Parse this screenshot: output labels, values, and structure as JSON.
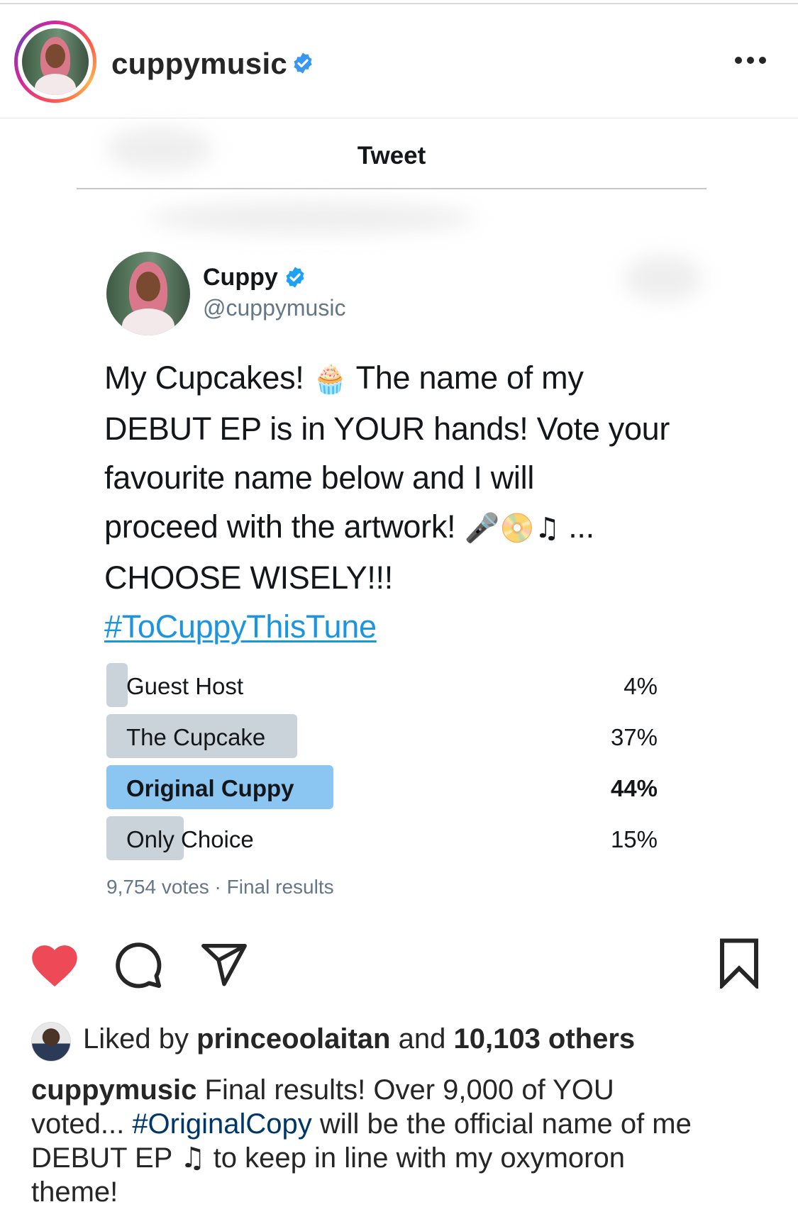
{
  "post": {
    "username": "cuppymusic",
    "verified": true,
    "more_icon": "more-horizontal-icon"
  },
  "tweet": {
    "header_title": "Tweet",
    "author_name": "Cuppy",
    "author_handle": "@cuppymusic",
    "text_lines": [
      "My Cupcakes! ",
      " The name of my",
      "DEBUT EP is in YOUR hands! Vote your",
      "favourite name below and I will",
      "proceed with the artwork! ",
      " ...",
      "CHOOSE WISELY!!!"
    ],
    "emojis": {
      "cupcake": "🧁",
      "microphone": "🎤",
      "disc": "📀",
      "music_note": "♫"
    },
    "hashtag": "#ToCuppyThisTune",
    "poll": {
      "options": [
        {
          "label": "Guest Host",
          "percent_text": "4%",
          "percent": 4,
          "winner": false
        },
        {
          "label": "The Cupcake",
          "percent_text": "37%",
          "percent": 37,
          "winner": false
        },
        {
          "label": "Original Cuppy",
          "percent_text": "44%",
          "percent": 44,
          "winner": true
        },
        {
          "label": "Only Choice",
          "percent_text": "15%",
          "percent": 15,
          "winner": false
        }
      ],
      "footer": "9,754 votes · Final results"
    }
  },
  "actions": {
    "like_icon": "heart-filled-icon",
    "comment_icon": "comment-icon",
    "share_icon": "paper-plane-icon",
    "save_icon": "bookmark-icon"
  },
  "likes": {
    "prefix": "Liked by ",
    "liker": "princeoolaitan",
    "middle": " and ",
    "count": "10,103 others"
  },
  "caption": {
    "username": "cuppymusic",
    "line1": " Final results! Over 9,000 of YOU",
    "line2_before": "voted... ",
    "hashtag": "#OriginalCopy",
    "line2_after": " will be the official name of me",
    "line3_before": "DEBUT EP ",
    "music_note": "♫",
    "line3_after": " to keep in line with my oxymoron",
    "line4": "theme!"
  },
  "colors": {
    "verified_blue": "#3897f0",
    "twitter_blue": "#1b95e0",
    "heart_red": "#ed4956",
    "poll_bar": "#cbd3da",
    "poll_winner": "#8bc5f2"
  }
}
